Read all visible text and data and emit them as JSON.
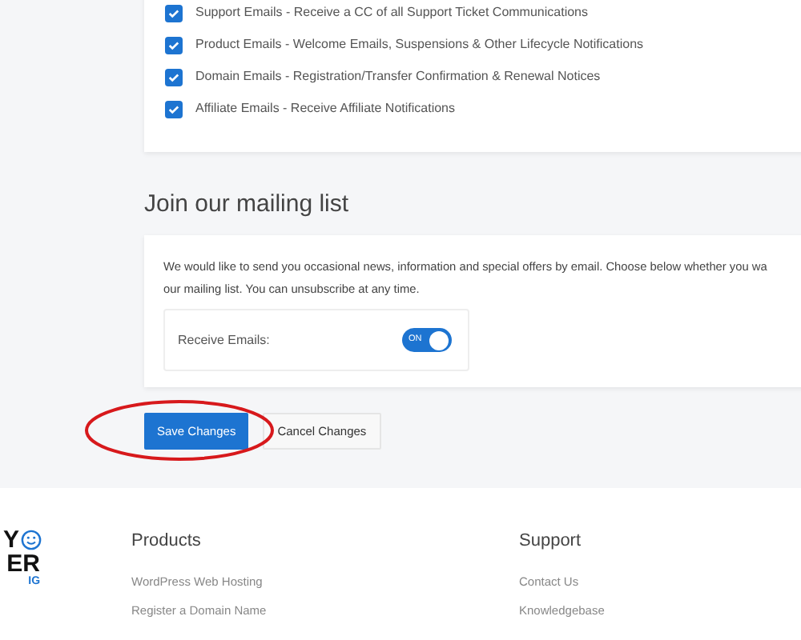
{
  "email_preferences": [
    {
      "label": "Support Emails - Receive a CC of all Support Ticket Communications",
      "checked": true
    },
    {
      "label": "Product Emails - Welcome Emails, Suspensions & Other Lifecycle Notifications",
      "checked": true
    },
    {
      "label": "Domain Emails - Registration/Transfer Confirmation & Renewal Notices",
      "checked": true
    },
    {
      "label": "Affiliate Emails - Receive Affiliate Notifications",
      "checked": true
    }
  ],
  "mailing_list": {
    "heading": "Join our mailing list",
    "description_line_1": "We would like to send you occasional news, information and special offers by email. Choose below whether you wa",
    "description_line_2": "our mailing list. You can unsubscribe at any time.",
    "toggle_label": "Receive Emails:",
    "toggle": {
      "on": true,
      "text": "ON"
    }
  },
  "buttons": [
    {
      "label": "Save Changes",
      "kind": "primary"
    },
    {
      "label": "Cancel Changes",
      "kind": "secondary"
    }
  ],
  "footer": {
    "logo_lines": [
      "Y",
      "ER",
      "IG"
    ],
    "columns": [
      {
        "heading": "Products",
        "links": [
          "WordPress Web Hosting",
          "Register a Domain Name"
        ]
      },
      {
        "heading": "Support",
        "links": [
          "Contact Us",
          "Knowledgebase"
        ]
      }
    ]
  }
}
